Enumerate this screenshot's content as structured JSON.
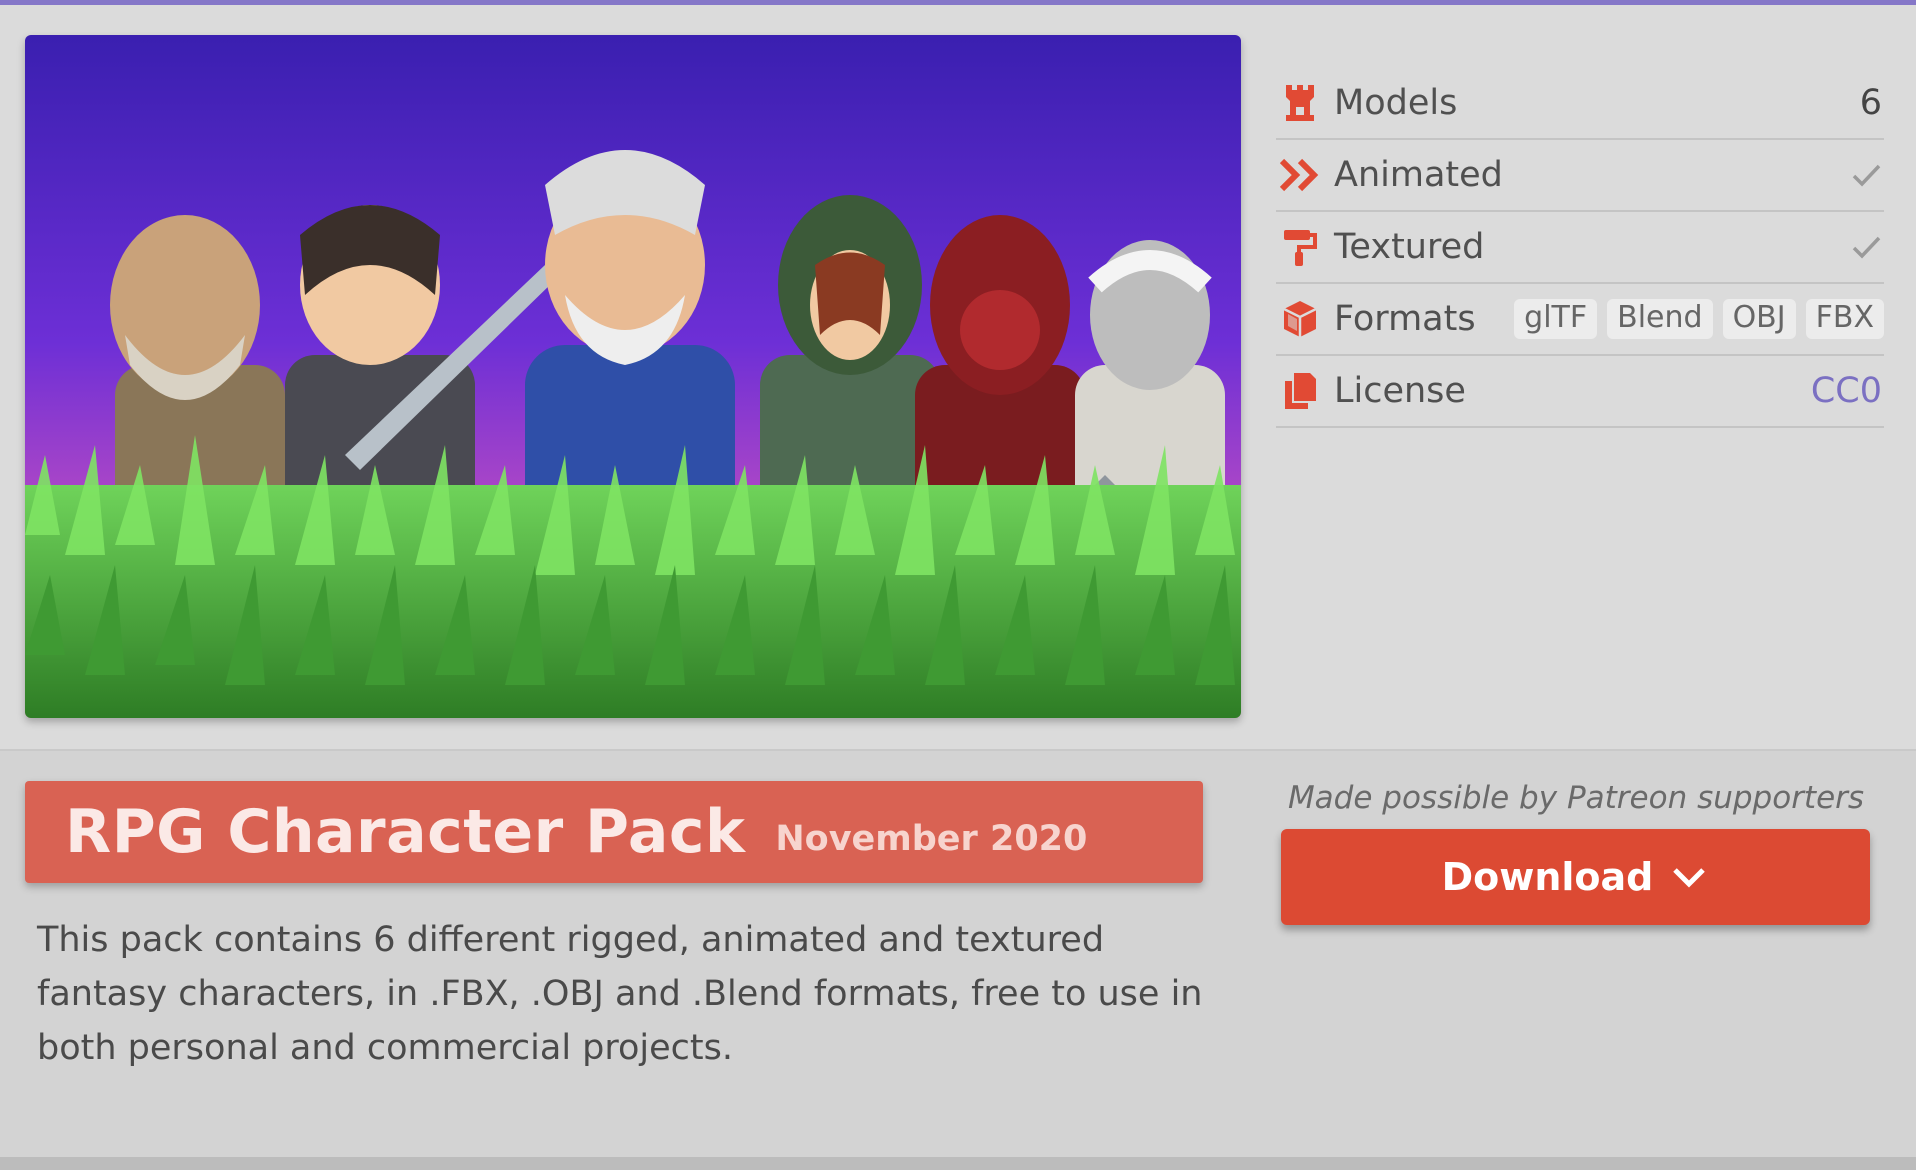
{
  "colors": {
    "accent": "#8577c8",
    "title_banner": "#d96253",
    "download_button": "#dc4a33",
    "icon_red": "#e14a34",
    "license_link": "#7b70c2"
  },
  "info": {
    "models": {
      "label": "Models",
      "value": "6",
      "icon": "castle-icon"
    },
    "animated": {
      "label": "Animated",
      "icon": "double-chevron-icon",
      "checked": true
    },
    "textured": {
      "label": "Textured",
      "icon": "paint-roller-icon",
      "checked": true
    },
    "formats": {
      "label": "Formats",
      "icon": "cube-icon",
      "badges": [
        "glTF",
        "Blend",
        "OBJ",
        "FBX"
      ]
    },
    "license": {
      "label": "License",
      "value": "CC0",
      "icon": "documents-icon"
    }
  },
  "pack": {
    "title": "RPG Character Pack",
    "date": "November 2020",
    "description": "This pack contains 6 different rigged, animated and textured fantasy characters, in .FBX, .OBJ and .Blend formats, free to use in both personal and commercial projects."
  },
  "download": {
    "note": "Made possible by Patreon supporters",
    "label": "Download",
    "icon": "chevron-down-icon"
  }
}
